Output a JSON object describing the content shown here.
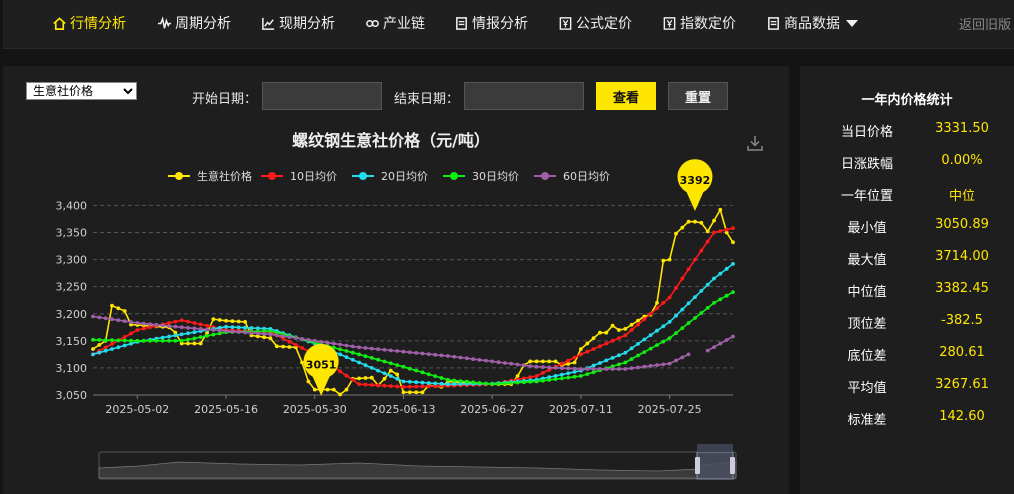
{
  "nav": {
    "items": [
      {
        "label": "行情分析",
        "icon": "home-icon",
        "active": true
      },
      {
        "label": "周期分析",
        "icon": "pulse-icon"
      },
      {
        "label": "现期分析",
        "icon": "line-chart-icon"
      },
      {
        "label": "产业链",
        "icon": "link-icon"
      },
      {
        "label": "情报分析",
        "icon": "document-icon"
      },
      {
        "label": "公式定价",
        "icon": "yen-doc-icon"
      },
      {
        "label": "指数定价",
        "icon": "yen-doc-icon"
      },
      {
        "label": "商品数据",
        "icon": "document-icon"
      }
    ],
    "back_label": "返回旧版"
  },
  "controls": {
    "select_value": "生意社价格",
    "start_label": "开始日期：",
    "end_label": "结束日期：",
    "start_value": "",
    "end_value": "",
    "query_label": "查看",
    "reset_label": "重置"
  },
  "stats": {
    "title": "一年内价格统计",
    "rows": [
      {
        "label": "当日价格",
        "value": "3331.50"
      },
      {
        "label": "日涨跌幅",
        "value": "0.00%"
      },
      {
        "label": "一年位置",
        "value": "中位"
      },
      {
        "label": "最小值",
        "value": "3050.89"
      },
      {
        "label": "最大值",
        "value": "3714.00"
      },
      {
        "label": "中位值",
        "value": "3382.45"
      },
      {
        "label": "顶位差",
        "value": "-382.5"
      },
      {
        "label": "底位差",
        "value": "280.61"
      },
      {
        "label": "平均值",
        "value": "3267.61"
      },
      {
        "label": "标准差",
        "value": "142.60"
      }
    ]
  },
  "chart_data": {
    "type": "line",
    "title": "螺纹钢生意社价格（元/吨）",
    "x_ticks": [
      "2025-05-02",
      "2025-05-16",
      "2025-05-30",
      "2025-06-13",
      "2025-06-27",
      "2025-07-11",
      "2025-07-25"
    ],
    "start_date": "2025-04-25",
    "end_date": "2025-08-04",
    "ylim": [
      3050,
      3410
    ],
    "y_ticks": [
      3050,
      3100,
      3150,
      3200,
      3250,
      3300,
      3350,
      3400
    ],
    "y_tick_labels": [
      "3,050",
      "3,100",
      "3,150",
      "3,200",
      "3,250",
      "3,300",
      "3,350",
      "3,400"
    ],
    "grid": true,
    "legend_position": "top",
    "annotations": [
      {
        "label": "3051",
        "date": "2025-05-31",
        "value": 3051,
        "marker": "min"
      },
      {
        "label": "3392",
        "date": "2025-07-29",
        "value": 3392,
        "marker": "max"
      }
    ],
    "series": [
      {
        "name": "生意社价格",
        "color": "#ffe600",
        "points": [
          [
            "2025-04-25",
            3135
          ],
          [
            "2025-04-27",
            3150
          ],
          [
            "2025-04-28",
            3215
          ],
          [
            "2025-04-30",
            3205
          ],
          [
            "2025-05-01",
            3180
          ],
          [
            "2025-05-07",
            3175
          ],
          [
            "2025-05-08",
            3165
          ],
          [
            "2025-05-09",
            3145
          ],
          [
            "2025-05-12",
            3145
          ],
          [
            "2025-05-13",
            3165
          ],
          [
            "2025-05-14",
            3190
          ],
          [
            "2025-05-16",
            3187
          ],
          [
            "2025-05-19",
            3185
          ],
          [
            "2025-05-20",
            3160
          ],
          [
            "2025-05-23",
            3155
          ],
          [
            "2025-05-24",
            3140
          ],
          [
            "2025-05-27",
            3138
          ],
          [
            "2025-05-28",
            3110
          ],
          [
            "2025-05-29",
            3075
          ],
          [
            "2025-05-30",
            3060
          ],
          [
            "2025-06-02",
            3060
          ],
          [
            "2025-06-03",
            3051
          ],
          [
            "2025-06-04",
            3060
          ],
          [
            "2025-06-05",
            3080
          ],
          [
            "2025-06-08",
            3082
          ],
          [
            "2025-06-09",
            3068
          ],
          [
            "2025-06-10",
            3080
          ],
          [
            "2025-06-11",
            3095
          ],
          [
            "2025-06-12",
            3088
          ],
          [
            "2025-06-13",
            3055
          ],
          [
            "2025-06-16",
            3055
          ],
          [
            "2025-06-17",
            3068
          ],
          [
            "2025-06-19",
            3065
          ],
          [
            "2025-06-20",
            3075
          ],
          [
            "2025-06-24",
            3072
          ],
          [
            "2025-06-26",
            3070
          ],
          [
            "2025-06-27",
            3070
          ],
          [
            "2025-06-30",
            3070
          ],
          [
            "2025-07-01",
            3085
          ],
          [
            "2025-07-02",
            3105
          ],
          [
            "2025-07-03",
            3112
          ],
          [
            "2025-07-07",
            3112
          ],
          [
            "2025-07-08",
            3105
          ],
          [
            "2025-07-10",
            3110
          ],
          [
            "2025-07-11",
            3135
          ],
          [
            "2025-07-14",
            3165
          ],
          [
            "2025-07-15",
            3165
          ],
          [
            "2025-07-16",
            3178
          ],
          [
            "2025-07-17",
            3170
          ],
          [
            "2025-07-18",
            3172
          ],
          [
            "2025-07-21",
            3195
          ],
          [
            "2025-07-22",
            3198
          ],
          [
            "2025-07-23",
            3220
          ],
          [
            "2025-07-24",
            3298
          ],
          [
            "2025-07-25",
            3300
          ],
          [
            "2025-07-26",
            3348
          ],
          [
            "2025-07-28",
            3370
          ],
          [
            "2025-07-29",
            3370
          ],
          [
            "2025-07-30",
            3368
          ],
          [
            "2025-07-31",
            3352
          ],
          [
            "2025-08-01",
            3372
          ],
          [
            "2025-08-02",
            3392
          ],
          [
            "2025-08-03",
            3350
          ],
          [
            "2025-08-04",
            3332
          ]
        ]
      },
      {
        "name": "10日均价",
        "color": "#ff1a1a",
        "points": [
          [
            "2025-04-25",
            3125
          ],
          [
            "2025-05-02",
            3170
          ],
          [
            "2025-05-09",
            3188
          ],
          [
            "2025-05-16",
            3170
          ],
          [
            "2025-05-23",
            3166
          ],
          [
            "2025-05-30",
            3125
          ],
          [
            "2025-06-06",
            3070
          ],
          [
            "2025-06-13",
            3065
          ],
          [
            "2025-06-20",
            3067
          ],
          [
            "2025-06-27",
            3070
          ],
          [
            "2025-07-04",
            3085
          ],
          [
            "2025-07-11",
            3125
          ],
          [
            "2025-07-18",
            3160
          ],
          [
            "2025-07-25",
            3230
          ],
          [
            "2025-07-29",
            3300
          ],
          [
            "2025-08-01",
            3350
          ],
          [
            "2025-08-04",
            3358
          ]
        ]
      },
      {
        "name": "20日均价",
        "color": "#22ddee",
        "points": [
          [
            "2025-04-25",
            3125
          ],
          [
            "2025-05-02",
            3148
          ],
          [
            "2025-05-09",
            3162
          ],
          [
            "2025-05-16",
            3176
          ],
          [
            "2025-05-23",
            3172
          ],
          [
            "2025-05-30",
            3145
          ],
          [
            "2025-06-06",
            3110
          ],
          [
            "2025-06-13",
            3075
          ],
          [
            "2025-06-20",
            3070
          ],
          [
            "2025-06-27",
            3071
          ],
          [
            "2025-07-04",
            3078
          ],
          [
            "2025-07-11",
            3095
          ],
          [
            "2025-07-18",
            3128
          ],
          [
            "2025-07-25",
            3185
          ],
          [
            "2025-08-01",
            3265
          ],
          [
            "2025-08-04",
            3292
          ]
        ]
      },
      {
        "name": "30日均价",
        "color": "#11ee11",
        "points": [
          [
            "2025-04-25",
            3152
          ],
          [
            "2025-05-02",
            3150
          ],
          [
            "2025-05-09",
            3150
          ],
          [
            "2025-05-16",
            3166
          ],
          [
            "2025-05-23",
            3168
          ],
          [
            "2025-05-30",
            3147
          ],
          [
            "2025-06-06",
            3125
          ],
          [
            "2025-06-13",
            3102
          ],
          [
            "2025-06-20",
            3078
          ],
          [
            "2025-06-27",
            3070
          ],
          [
            "2025-07-04",
            3075
          ],
          [
            "2025-07-11",
            3085
          ],
          [
            "2025-07-18",
            3110
          ],
          [
            "2025-07-25",
            3155
          ],
          [
            "2025-08-01",
            3220
          ],
          [
            "2025-08-04",
            3240
          ]
        ]
      },
      {
        "name": "60日均价",
        "color": "#a060a8",
        "points": [
          [
            "2025-04-25",
            3195
          ],
          [
            "2025-05-02",
            3183
          ],
          [
            "2025-05-09",
            3175
          ],
          [
            "2025-05-16",
            3168
          ],
          [
            "2025-05-23",
            3162
          ],
          [
            "2025-05-30",
            3150
          ],
          [
            "2025-06-06",
            3138
          ],
          [
            "2025-06-13",
            3130
          ],
          [
            "2025-06-20",
            3122
          ],
          [
            "2025-06-27",
            3112
          ],
          [
            "2025-07-04",
            3102
          ],
          [
            "2025-07-11",
            3098
          ],
          [
            "2025-07-18",
            3098
          ],
          [
            "2025-07-25",
            3108
          ],
          [
            "2025-07-28",
            3125
          ],
          null,
          [
            "2025-07-31",
            3132
          ],
          [
            "2025-08-04",
            3158
          ]
        ]
      }
    ]
  }
}
